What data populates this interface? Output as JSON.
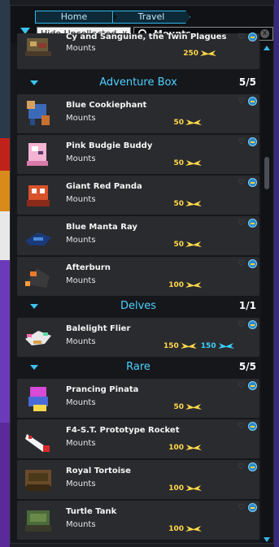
{
  "nav": {
    "breadcrumbs": [
      "Home",
      "Travel"
    ]
  },
  "filter": {
    "selected": "Hide Uncollected"
  },
  "search": {
    "value": "Mounts"
  },
  "colors": {
    "accent": "#3cc3f0",
    "section_title": "#4fd0ff",
    "flux_gold": "#ffd84a",
    "flux_blue": "#3ad0ff"
  },
  "partial_item": {
    "name": "Cy and Sanguine, the Twin Plagues",
    "type": "Mounts",
    "price": "250"
  },
  "sections": [
    {
      "title": "Adventure Box",
      "count": "5/5",
      "items": [
        {
          "name": "Blue Cookiephant",
          "type": "Mounts",
          "price": "50",
          "icon": "elephant-mount-icon"
        },
        {
          "name": "Pink Budgie Buddy",
          "type": "Mounts",
          "price": "50",
          "icon": "budgie-mount-icon"
        },
        {
          "name": "Giant Red Panda",
          "type": "Mounts",
          "price": "50",
          "icon": "red-panda-mount-icon"
        },
        {
          "name": "Blue Manta Ray",
          "type": "Mounts",
          "price": "50",
          "icon": "manta-ray-mount-icon"
        },
        {
          "name": "Afterburn",
          "type": "Mounts",
          "price": "100",
          "icon": "afterburn-mount-icon"
        }
      ]
    },
    {
      "title": "Delves",
      "count": "1/1",
      "items": [
        {
          "name": "Balelight Flier",
          "type": "Mounts",
          "price": "150",
          "price2": "150",
          "icon": "balelight-flier-icon"
        }
      ]
    },
    {
      "title": "Rare",
      "count": "5/5",
      "items": [
        {
          "name": "Prancing Pinata",
          "type": "Mounts",
          "price": "50",
          "icon": "pinata-mount-icon"
        },
        {
          "name": "F4-S.T. Prototype Rocket",
          "type": "Mounts",
          "price": "100",
          "icon": "rocket-mount-icon"
        },
        {
          "name": "Royal Tortoise",
          "type": "Mounts",
          "price": "100",
          "icon": "tortoise-mount-icon"
        },
        {
          "name": "Turtle Tank",
          "type": "Mounts",
          "price": "100",
          "icon": "turtle-tank-mount-icon"
        }
      ]
    }
  ]
}
